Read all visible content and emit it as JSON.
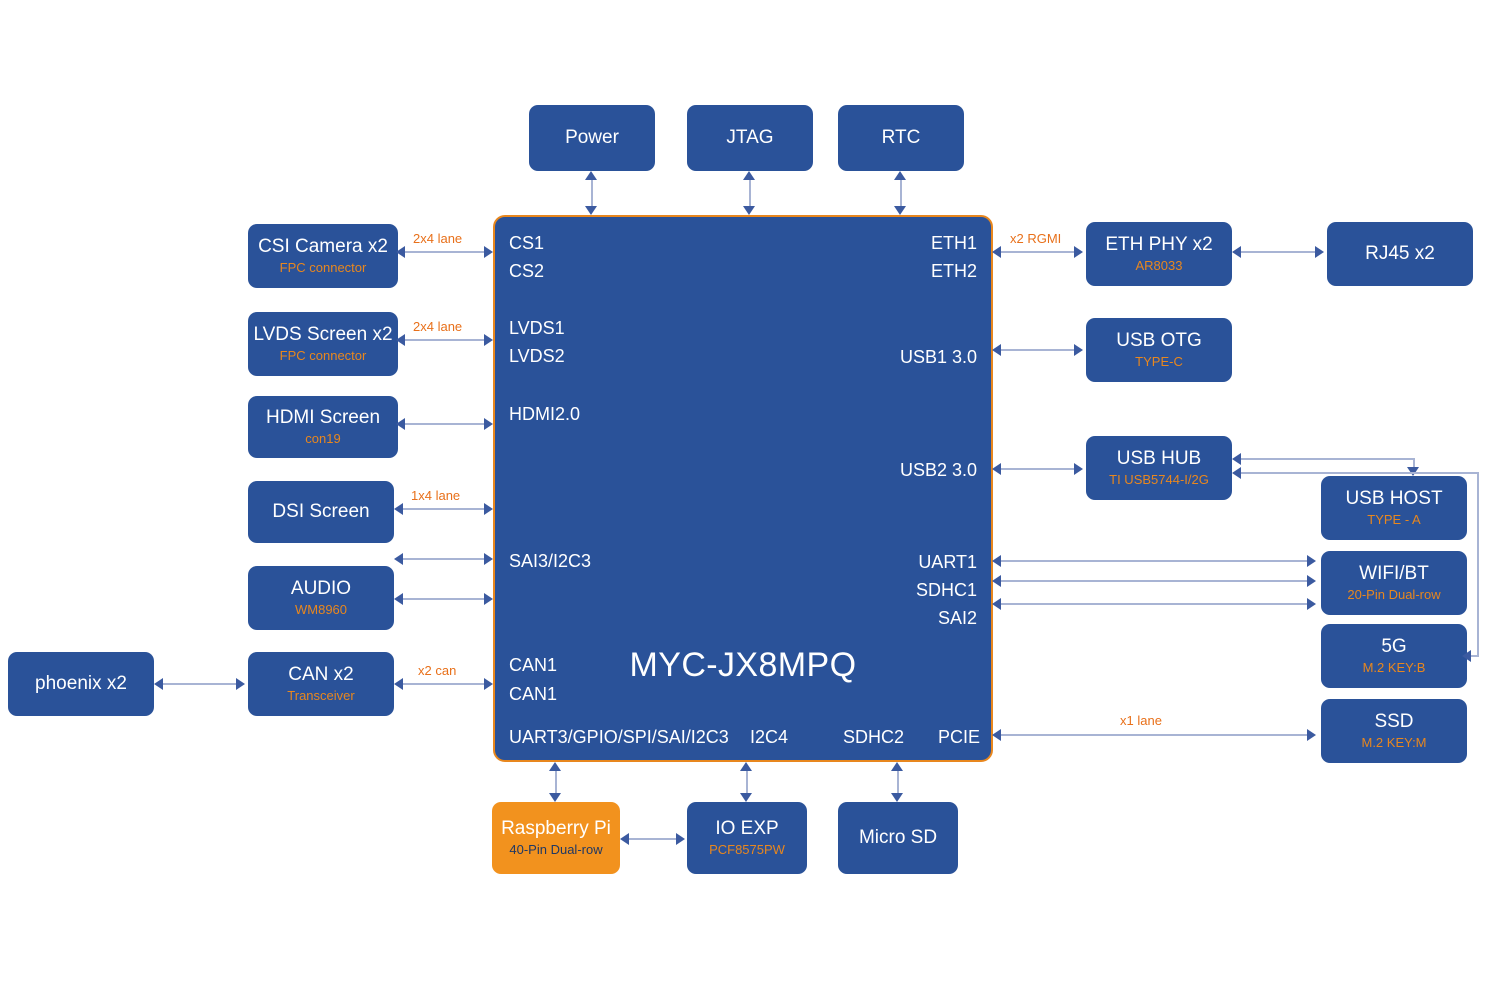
{
  "diagram": {
    "title": "MYC-JX8MPQ",
    "colors": {
      "box_blue": "#2a5299",
      "box_orange": "#f2921e",
      "accent_orange": "#e8871e",
      "label_orange": "#e8701a",
      "line": "#a8b4d4",
      "arrow": "#3b5aa0",
      "background": "#ffffff"
    }
  },
  "soc": {
    "name": "MYC-JX8MPQ",
    "pins_left": [
      {
        "label": "CS1"
      },
      {
        "label": "CS2"
      },
      {
        "label": "LVDS1"
      },
      {
        "label": "LVDS2"
      },
      {
        "label": "HDMI2.0"
      },
      {
        "label": "SAI3/I2C3"
      },
      {
        "label": "CAN1"
      },
      {
        "label": "CAN1"
      }
    ],
    "pins_right": [
      {
        "label": "ETH1"
      },
      {
        "label": "ETH2"
      },
      {
        "label": "USB1 3.0"
      },
      {
        "label": "USB2 3.0"
      },
      {
        "label": "UART1"
      },
      {
        "label": "SDHC1"
      },
      {
        "label": "SAI2"
      }
    ],
    "pins_bottom": [
      {
        "label": "UART3/GPIO/SPI/SAI/I2C3"
      },
      {
        "label": "I2C4"
      },
      {
        "label": "SDHC2"
      },
      {
        "label": "PCIE"
      }
    ]
  },
  "blocks": {
    "power": {
      "title": "Power",
      "subtitle": ""
    },
    "jtag": {
      "title": "JTAG",
      "subtitle": ""
    },
    "rtc": {
      "title": "RTC",
      "subtitle": ""
    },
    "csi_camera": {
      "title": "CSI Camera x2",
      "subtitle": "FPC  connector"
    },
    "lvds_screen": {
      "title": "LVDS Screen x2",
      "subtitle": "FPC  connector"
    },
    "hdmi_screen": {
      "title": "HDMI Screen",
      "subtitle": "con19"
    },
    "dsi_screen": {
      "title": "DSI Screen",
      "subtitle": ""
    },
    "audio": {
      "title": "AUDIO",
      "subtitle": "WM8960"
    },
    "can": {
      "title": "CAN x2",
      "subtitle": "Transceiver"
    },
    "phoenix": {
      "title": "phoenix x2",
      "subtitle": ""
    },
    "raspberry_pi": {
      "title": "Raspberry Pi",
      "subtitle": "40-Pin Dual-row"
    },
    "io_exp": {
      "title": "IO  EXP",
      "subtitle": "PCF8575PW"
    },
    "micro_sd": {
      "title": "Micro SD",
      "subtitle": ""
    },
    "eth_phy": {
      "title": "ETH PHY x2",
      "subtitle": "AR8033"
    },
    "rj45": {
      "title": "RJ45 x2",
      "subtitle": ""
    },
    "usb_otg": {
      "title": "USB OTG",
      "subtitle": "TYPE-C"
    },
    "usb_hub": {
      "title": "USB HUB",
      "subtitle": "TI  USB5744-I/2G"
    },
    "usb_host": {
      "title": "USB HOST",
      "subtitle": "TYPE - A"
    },
    "wifi_bt": {
      "title": "WIFI/BT",
      "subtitle": "20-Pin Dual-row"
    },
    "fiveg": {
      "title": "5G",
      "subtitle": "M.2 KEY:B"
    },
    "ssd": {
      "title": "SSD",
      "subtitle": "M.2 KEY:M"
    }
  },
  "link_labels": {
    "csi_lane": "2x4 lane",
    "lvds_lane": "2x4 lane",
    "dsi_lane": "1x4 lane",
    "can_lanes": "x2 can",
    "eth_rgmi": "x2 RGMI",
    "pcie_lane": "x1 lane"
  }
}
